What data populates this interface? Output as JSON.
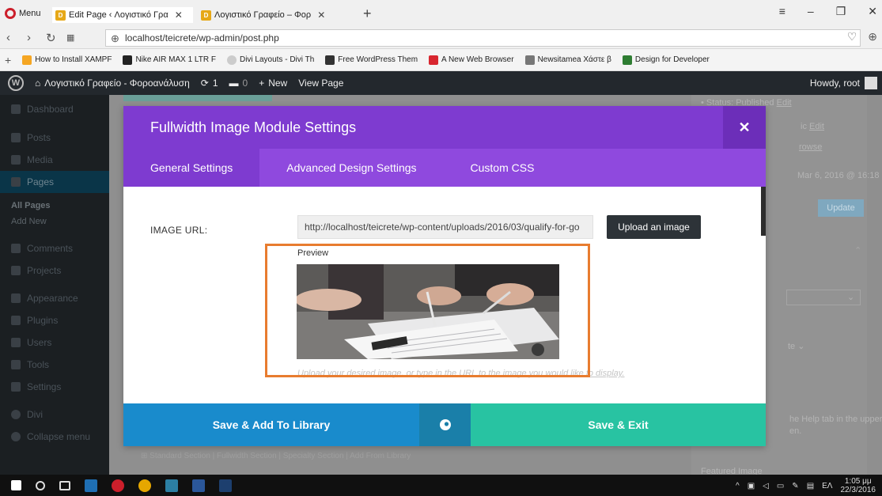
{
  "browser": {
    "menu_label": "Menu",
    "tabs": [
      {
        "label": "Edit Page ‹ Λογιστικό Γρα"
      },
      {
        "label": "Λογιστικό Γραφείο – Φορ"
      }
    ],
    "url": "localhost/teicrete/wp-admin/post.php",
    "bookmarks": [
      {
        "label": "How to Install XAMPF"
      },
      {
        "label": "Nike AIR MAX 1 LTR F"
      },
      {
        "label": "Divi Layouts - Divi Th"
      },
      {
        "label": "Free WordPress Them"
      },
      {
        "label": "A New Web Browser"
      },
      {
        "label": "Newsitamea Χάστε β"
      },
      {
        "label": "Design for Developer"
      }
    ]
  },
  "adminbar": {
    "site_name": "Λογιστικό Γραφείο - Φοροανάλυση",
    "updates_count": "1",
    "comments_count": "0",
    "new_label": "New",
    "view_page_label": "View Page",
    "howdy": "Howdy, root"
  },
  "sidebar": {
    "items": [
      {
        "label": "Dashboard"
      },
      {
        "label": "Posts"
      },
      {
        "label": "Media"
      },
      {
        "label": "Pages"
      },
      {
        "label": "Comments"
      },
      {
        "label": "Projects"
      },
      {
        "label": "Appearance"
      },
      {
        "label": "Plugins"
      },
      {
        "label": "Users"
      },
      {
        "label": "Tools"
      },
      {
        "label": "Settings"
      },
      {
        "label": "Divi"
      },
      {
        "label": "Collapse menu"
      }
    ],
    "sub_all_pages": "All Pages",
    "sub_add_new": "Add New"
  },
  "background": {
    "status": "Status: Published",
    "edit1": "Edit",
    "visibility_tail": "ic",
    "edit2": "Edit",
    "browse": "rowse",
    "date": "Mar 6, 2016 @ 16:18",
    "update_label": "Update",
    "template_tail": "te",
    "help_line1": "he Help tab in the upper",
    "help_line2": "en.",
    "featured_image": "Featured Image",
    "builder_bar": "Standard Section  |  Fullwidth Section  |  Specialty Section  |  Add From Library"
  },
  "modal": {
    "title": "Fullwidth Image Module Settings",
    "tabs": [
      {
        "label": "General Settings"
      },
      {
        "label": "Advanced Design Settings"
      },
      {
        "label": "Custom CSS"
      }
    ],
    "image_url_label": "IMAGE URL:",
    "image_url_value": "http://localhost/teicrete/wp-content/uploads/2016/03/qualify-for-go",
    "upload_label": "Upload an image",
    "preview_label": "Preview",
    "hint": "Upload your desired image, or type in the URL to the image you would like to display.",
    "save_library_label": "Save & Add To Library",
    "save_exit_label": "Save & Exit"
  },
  "taskbar": {
    "lang": "ΕΛ",
    "time": "1:05 μμ",
    "date": "22/3/2016"
  },
  "colors": {
    "modal_header": "#7e3bd0",
    "modal_tabs": "#8f49de",
    "save_library": "#198bcc",
    "save_exit": "#28c3a2",
    "highlight": "#e87c2f"
  }
}
